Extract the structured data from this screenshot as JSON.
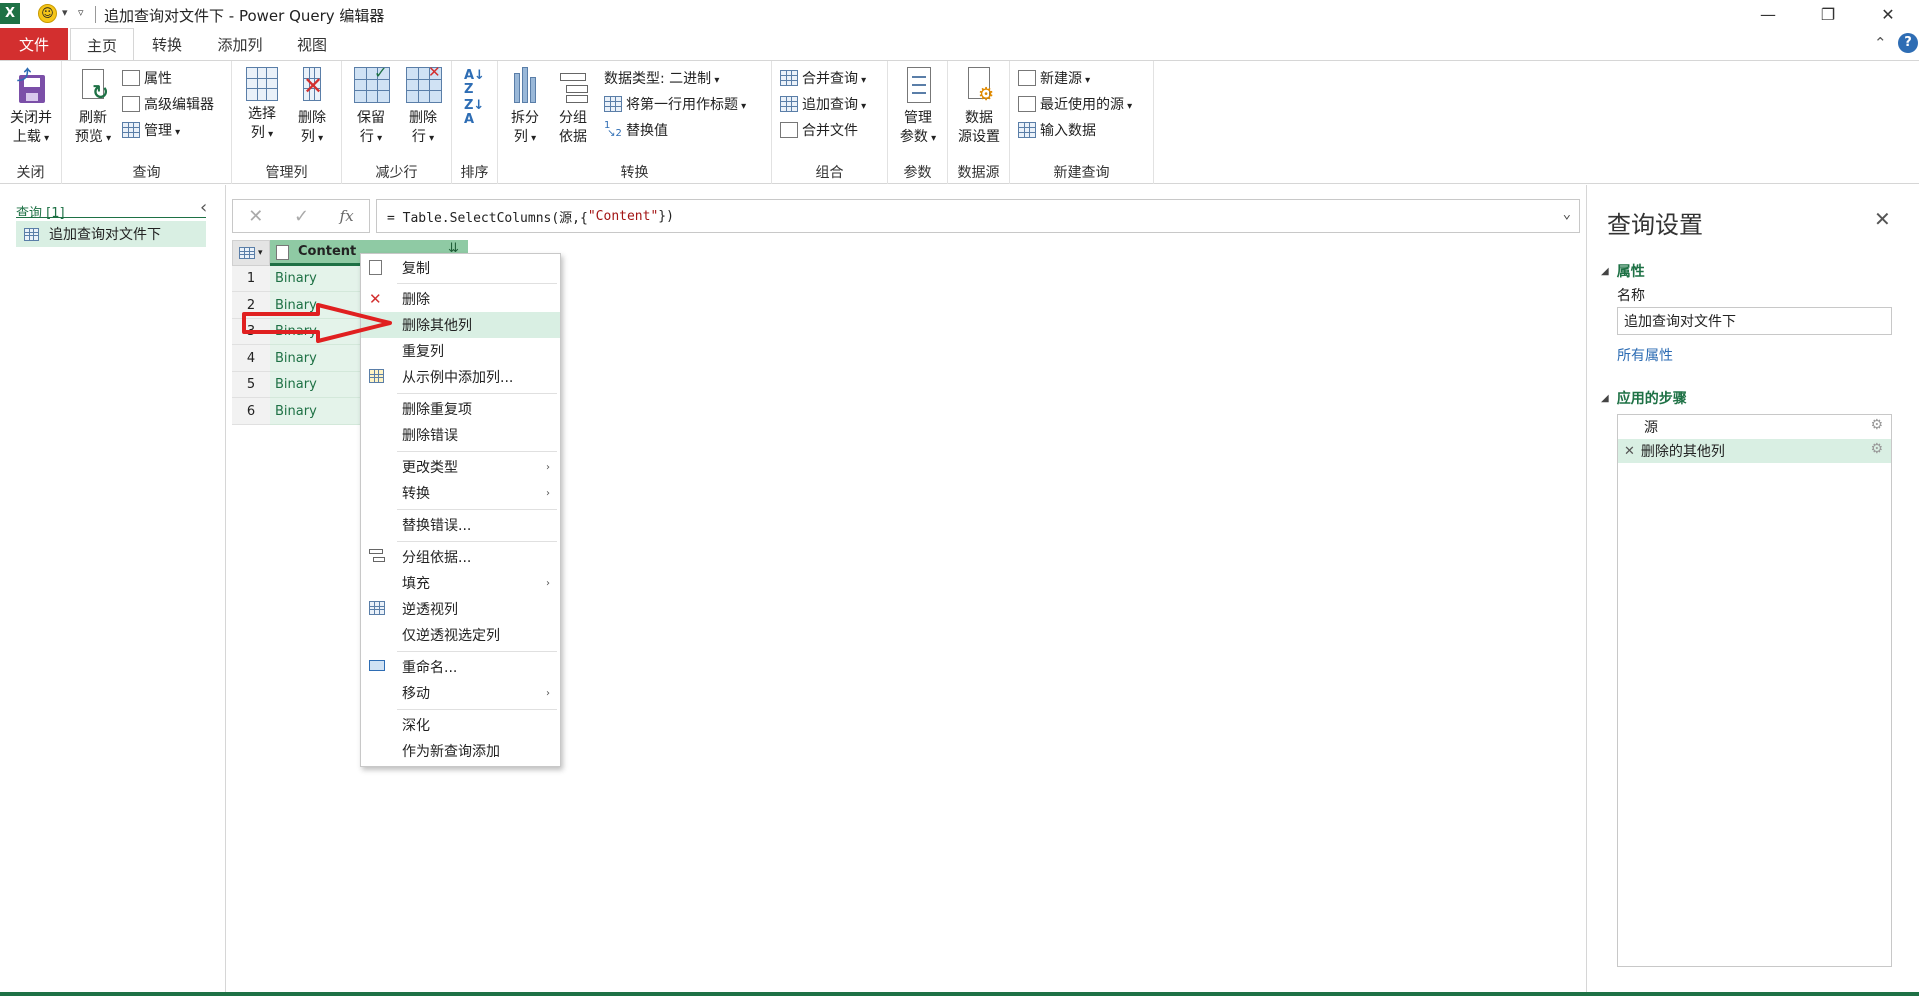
{
  "window": {
    "title": "追加查询对文件下 - Power Query 编辑器",
    "app_logo": "X",
    "controls": {
      "minimize": "—",
      "restore": "❐",
      "close": "✕"
    },
    "collapse_ribbon": "⌃",
    "help": "?"
  },
  "tabs": [
    {
      "label": "文件"
    },
    {
      "label": "主页"
    },
    {
      "label": "转换"
    },
    {
      "label": "添加列"
    },
    {
      "label": "视图"
    }
  ],
  "ribbon": {
    "close_group": {
      "label": "关闭",
      "close_load": [
        "关闭并",
        "上载"
      ]
    },
    "query_group": {
      "label": "查询",
      "refresh": [
        "刷新",
        "预览"
      ],
      "properties": "属性",
      "advanced_editor": "高级编辑器",
      "manage": "管理"
    },
    "manage_cols_group": {
      "label": "管理列",
      "choose_cols": [
        "选择",
        "列"
      ],
      "remove_cols": [
        "删除",
        "列"
      ]
    },
    "reduce_rows_group": {
      "label": "减少行",
      "keep_rows": [
        "保留",
        "行"
      ],
      "remove_rows": [
        "删除",
        "行"
      ]
    },
    "sort_group": {
      "label": "排序"
    },
    "transform_group": {
      "label": "转换",
      "split_col": [
        "拆分",
        "列"
      ],
      "group_by": [
        "分组",
        "依据"
      ],
      "data_type": "数据类型: 二进制",
      "first_row_header": "将第一行用作标题",
      "replace_values": "替换值"
    },
    "combine_group": {
      "label": "组合",
      "merge_queries": "合并查询",
      "append_queries": "追加查询",
      "combine_files": "合并文件"
    },
    "params_group": {
      "label": "参数",
      "manage_params": [
        "管理",
        "参数"
      ]
    },
    "datasource_group": {
      "label": "数据源",
      "ds_settings": [
        "数据",
        "源设置"
      ]
    },
    "newquery_group": {
      "label": "新建查询",
      "new_source": "新建源",
      "recent_sources": "最近使用的源",
      "enter_data": "输入数据"
    }
  },
  "left_panel": {
    "header": "查询 [1]",
    "queries": [
      "追加查询对文件下"
    ]
  },
  "formula_bar": {
    "fx": "fx",
    "formula_prefix": "= Table.SelectColumns(源,{",
    "formula_string": "\"Content\"",
    "formula_suffix": "})"
  },
  "grid": {
    "column_header": "Content",
    "rows": [
      {
        "num": "1",
        "value": "Binary"
      },
      {
        "num": "2",
        "value": "Binary"
      },
      {
        "num": "3",
        "value": "Binary"
      },
      {
        "num": "4",
        "value": "Binary"
      },
      {
        "num": "5",
        "value": "Binary"
      },
      {
        "num": "6",
        "value": "Binary"
      }
    ]
  },
  "context_menu": {
    "items": [
      "复制",
      "删除",
      "删除其他列",
      "重复列",
      "从示例中添加列...",
      "删除重复项",
      "删除错误",
      "更改类型",
      "转换",
      "替换错误...",
      "分组依据...",
      "填充",
      "逆透视列",
      "仅逆透视选定列",
      "重命名...",
      "移动",
      "深化",
      "作为新查询添加"
    ],
    "submenu_arrow": "›"
  },
  "right_panel": {
    "title": "查询设置",
    "properties_header": "属性",
    "name_label": "名称",
    "name_value": "追加查询对文件下",
    "all_properties": "所有属性",
    "steps_header": "应用的步骤",
    "steps": [
      "源",
      "删除的其他列"
    ]
  },
  "colors": {
    "accent": "#1e7145",
    "file_tab": "#d32f2f",
    "highlight": "#d9efe3",
    "link": "#2e6db4",
    "annotation_arrow": "#e02020"
  }
}
